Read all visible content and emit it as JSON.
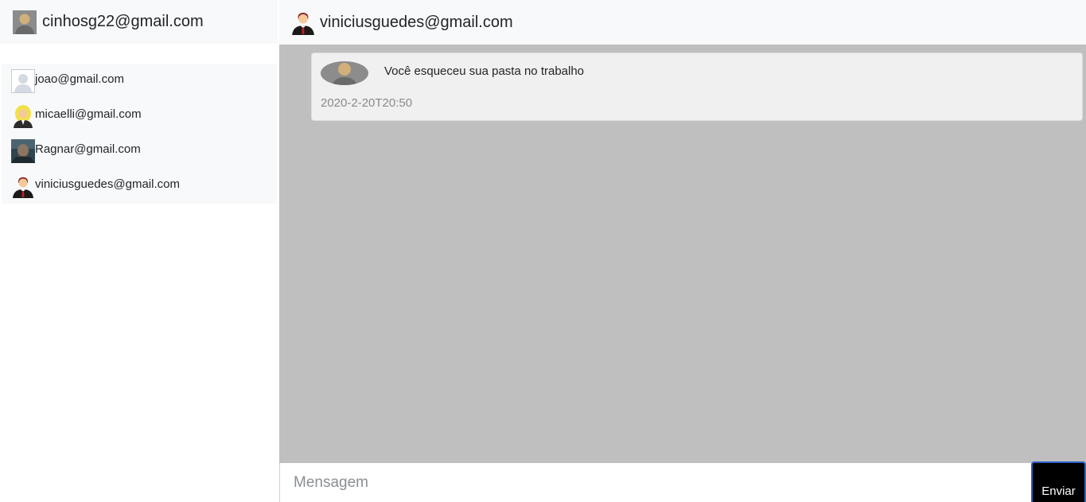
{
  "current_user": {
    "email": "cinhosg22@gmail.com",
    "avatar_icon": "gray-person-avatar-icon"
  },
  "contacts": [
    {
      "email": "joao@gmail.com",
      "avatar_icon": "default-user-avatar-icon"
    },
    {
      "email": "micaelli@gmail.com",
      "avatar_icon": "blonde-woman-avatar-icon"
    },
    {
      "email": "Ragnar@gmail.com",
      "avatar_icon": "photo-avatar-icon"
    },
    {
      "email": "viniciusguedes@gmail.com",
      "avatar_icon": "businessman-avatar-icon"
    }
  ],
  "chat": {
    "contact_email": "viniciusguedes@gmail.com",
    "contact_avatar_icon": "businessman-avatar-icon",
    "messages": [
      {
        "text": "Você esqueceu sua pasta no trabalho",
        "timestamp": "2020-2-20T20:50",
        "avatar_icon": "gray-person-avatar-icon"
      }
    ]
  },
  "composer": {
    "placeholder": "Mensagem",
    "value": "",
    "send_label": "Enviar"
  },
  "colors": {
    "header_bg": "#f8f9fa",
    "chat_bg": "#bfbfbf",
    "message_bg": "#f0f0f0",
    "send_bg": "#000000",
    "send_border": "#2b63c8"
  }
}
